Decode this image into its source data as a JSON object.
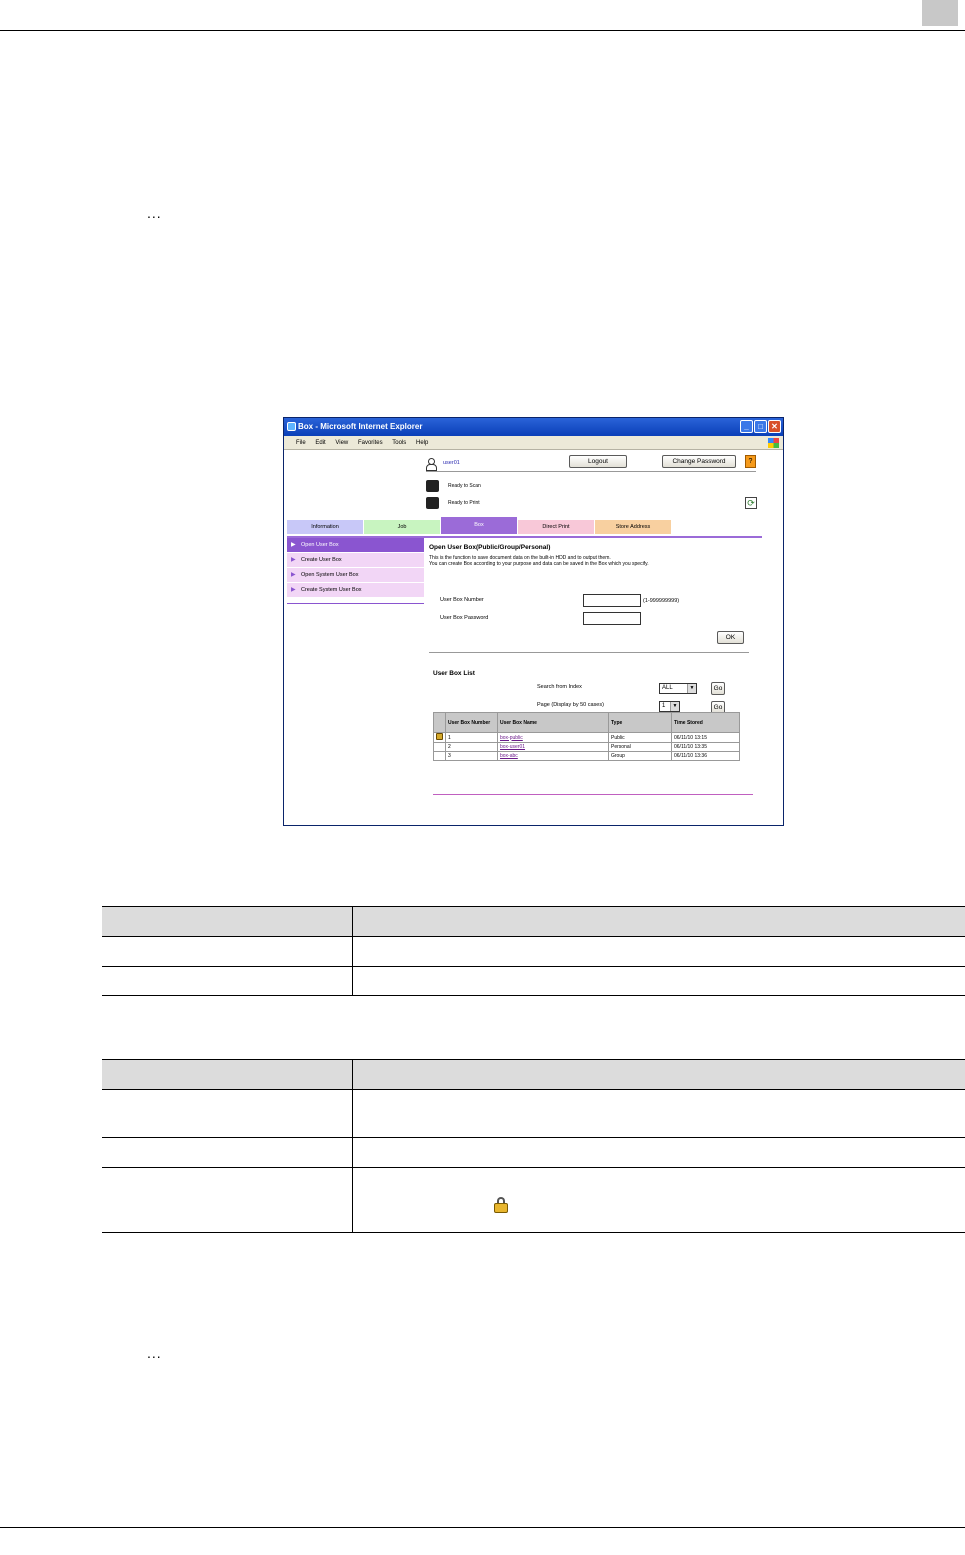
{
  "browser": {
    "title": "Box - Microsoft Internet Explorer",
    "menu": [
      "File",
      "Edit",
      "View",
      "Favorites",
      "Tools",
      "Help"
    ]
  },
  "header": {
    "user_name": "user01",
    "logout_label": "Logout",
    "change_password_label": "Change Password",
    "help_label": "?"
  },
  "status": {
    "scan": "Ready to Scan",
    "print": "Ready to Print"
  },
  "tabs": [
    {
      "label": "Information",
      "color": "#c8c8f8"
    },
    {
      "label": "Job",
      "color": "#c8f4c0"
    },
    {
      "label": "Box",
      "color": "#9b6bd8"
    },
    {
      "label": "Direct Print",
      "color": "#f8c8d8"
    },
    {
      "label": "Store Address",
      "color": "#f8d0a0"
    }
  ],
  "side_menu": [
    {
      "label": "Open User Box"
    },
    {
      "label": "Create User Box"
    },
    {
      "label": "Open System User Box"
    },
    {
      "label": "Create System User Box"
    }
  ],
  "open_box": {
    "heading": "Open User Box(Public/Group/Personal)",
    "desc_line1": "This is the function to save document data on the built-in HDD and to output them.",
    "desc_line2": "You can create Box according to your purpose and data can be saved in the Box which you specify.",
    "number_label": "User Box Number",
    "number_value": "",
    "number_range": "(1-999999999)",
    "password_label": "User Box Password",
    "password_value": "",
    "ok_label": "OK"
  },
  "box_list": {
    "heading": "User Box List",
    "search_label": "Search from Index",
    "search_value": "ALL",
    "page_label": "Page (Display by 50 cases)",
    "page_value": "1",
    "go_label": "Go",
    "columns": [
      "User Box Number",
      "User Box Name",
      "Type",
      "Time Stored"
    ],
    "rows": [
      {
        "number": "1",
        "name": "box-public",
        "type": "Public",
        "time": "06/11/10 13:15"
      },
      {
        "number": "2",
        "name": "box-user01",
        "type": "Personal",
        "time": "06/11/10 13:35"
      },
      {
        "number": "3",
        "name": "box-abc",
        "type": "Group",
        "time": "06/11/10 13:36"
      }
    ]
  },
  "page": {
    "ellipsis_top": "...",
    "ellipsis_bottom": "..."
  }
}
